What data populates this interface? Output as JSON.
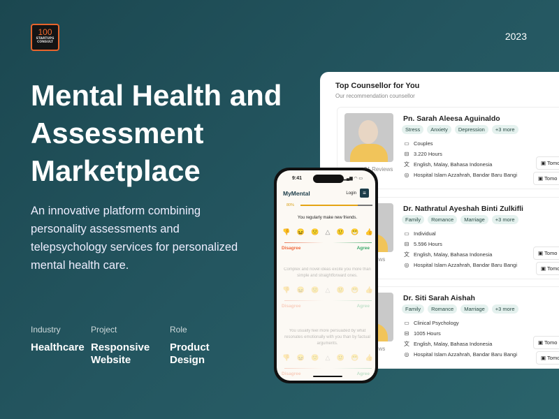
{
  "brand": {
    "logo_number": "100",
    "logo_text_1": "STARTUPS",
    "logo_text_2": "CONSULT"
  },
  "year": "2023",
  "title": "Mental Health and Assessment Marketplace",
  "description": "An innovative platform combining personality assessments and telepsychology services for personalized mental health care.",
  "meta": [
    {
      "label": "Industry",
      "value": "Healthcare"
    },
    {
      "label": "Project",
      "value": "Responsive Website"
    },
    {
      "label": "Role",
      "value": "Product Design"
    }
  ],
  "panel": {
    "title": "Top Counsellor for You",
    "subtitle": "Our recommendation counsellor",
    "counsellors": [
      {
        "name": "Pn. Sarah Aleesa Aguinaldo",
        "tags": [
          "Stress",
          "Anxiety",
          "Depression",
          "+3 more"
        ],
        "type": "Couples",
        "hours": "3.220 Hours",
        "languages": "English, Malay, Bahasa Indonesia",
        "location": "Hospital Islam Azzahrah, Bandar Baru Bangi",
        "reviews": "31 Reviews",
        "slot": "Tomo"
      },
      {
        "name": "Dr. Nathratul Ayeshah Binti Zulkifli",
        "tags": [
          "Family",
          "Romance",
          "Marriage",
          "+3 more"
        ],
        "type": "Individual",
        "hours": "5.596 Hours",
        "languages": "English, Malay, Bahasa Indonesia",
        "location": "Hospital Islam Azzahrah, Bandar Baru Bangi",
        "reviews": "Reviews",
        "slot": "Tomo"
      },
      {
        "name": "Dr. Siti Sarah Aishah",
        "tags": [
          "Family",
          "Romance",
          "Marriage",
          "+3 more"
        ],
        "type": "Clinical Psychology",
        "hours": "1005 Hours",
        "languages": "English, Malay, Bahasa Indonesia",
        "location": "Hospital Islam Azzahrah, Bandar Baru Bangi",
        "reviews": "Reviews",
        "slot": "Tomo"
      }
    ]
  },
  "phone": {
    "time": "9:41",
    "status": "▂▄▆ ◠ ▭",
    "brand": "MyMental",
    "login": "Login",
    "progress_label": "80%",
    "progress": 0.8,
    "questions": [
      "You regularly make new friends.",
      "Complex and novel ideas excite you more than simple and straightforward ones.",
      "You usually feel more persuaded by what resonates emotionally with you than by factual arguments."
    ],
    "disagree": "Disagree",
    "agree": "Agree"
  },
  "colors": {
    "accent": "#e4a414",
    "disagree": "#f0693c",
    "agree": "#3aa86b",
    "logo": "#f26a2e"
  }
}
